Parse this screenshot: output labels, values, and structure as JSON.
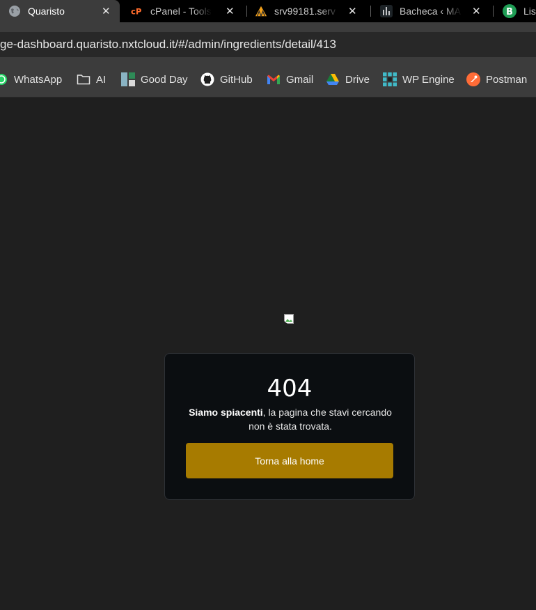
{
  "browser": {
    "tabs": [
      {
        "title": "Quaristo",
        "icon": "globe-icon",
        "active": true
      },
      {
        "title": "cPanel - Tools",
        "icon": "cpanel-icon"
      },
      {
        "title": "srv99181.serv",
        "icon": "server-icon"
      },
      {
        "title": "Bacheca ‹ MA",
        "icon": "bar-chart-icon"
      },
      {
        "title": "Lis",
        "icon": "b-letter-icon"
      }
    ],
    "close_glyph": "✕",
    "address": "ge-dashboard.quaristo.nxtcloud.it/#/admin/ingredients/detail/413",
    "bookmarks": [
      {
        "label": "WhatsApp",
        "icon": "whatsapp-icon"
      },
      {
        "label": "AI",
        "icon": "folder-icon"
      },
      {
        "label": "Good Day",
        "icon": "goodday-icon"
      },
      {
        "label": "GitHub",
        "icon": "github-icon"
      },
      {
        "label": "Gmail",
        "icon": "gmail-icon"
      },
      {
        "label": "Drive",
        "icon": "drive-icon"
      },
      {
        "label": "WP Engine",
        "icon": "wpengine-icon"
      },
      {
        "label": "Postman",
        "icon": "postman-icon"
      }
    ]
  },
  "error_page": {
    "code": "404",
    "message_bold": "Siamo spiacenti",
    "message_rest": ", la pagina che stavi cercando non è stata trovata.",
    "button_label": "Torna alla home"
  },
  "colors": {
    "button": "#a77b00",
    "card": "#0b0e11",
    "background": "#1f1f1f"
  }
}
